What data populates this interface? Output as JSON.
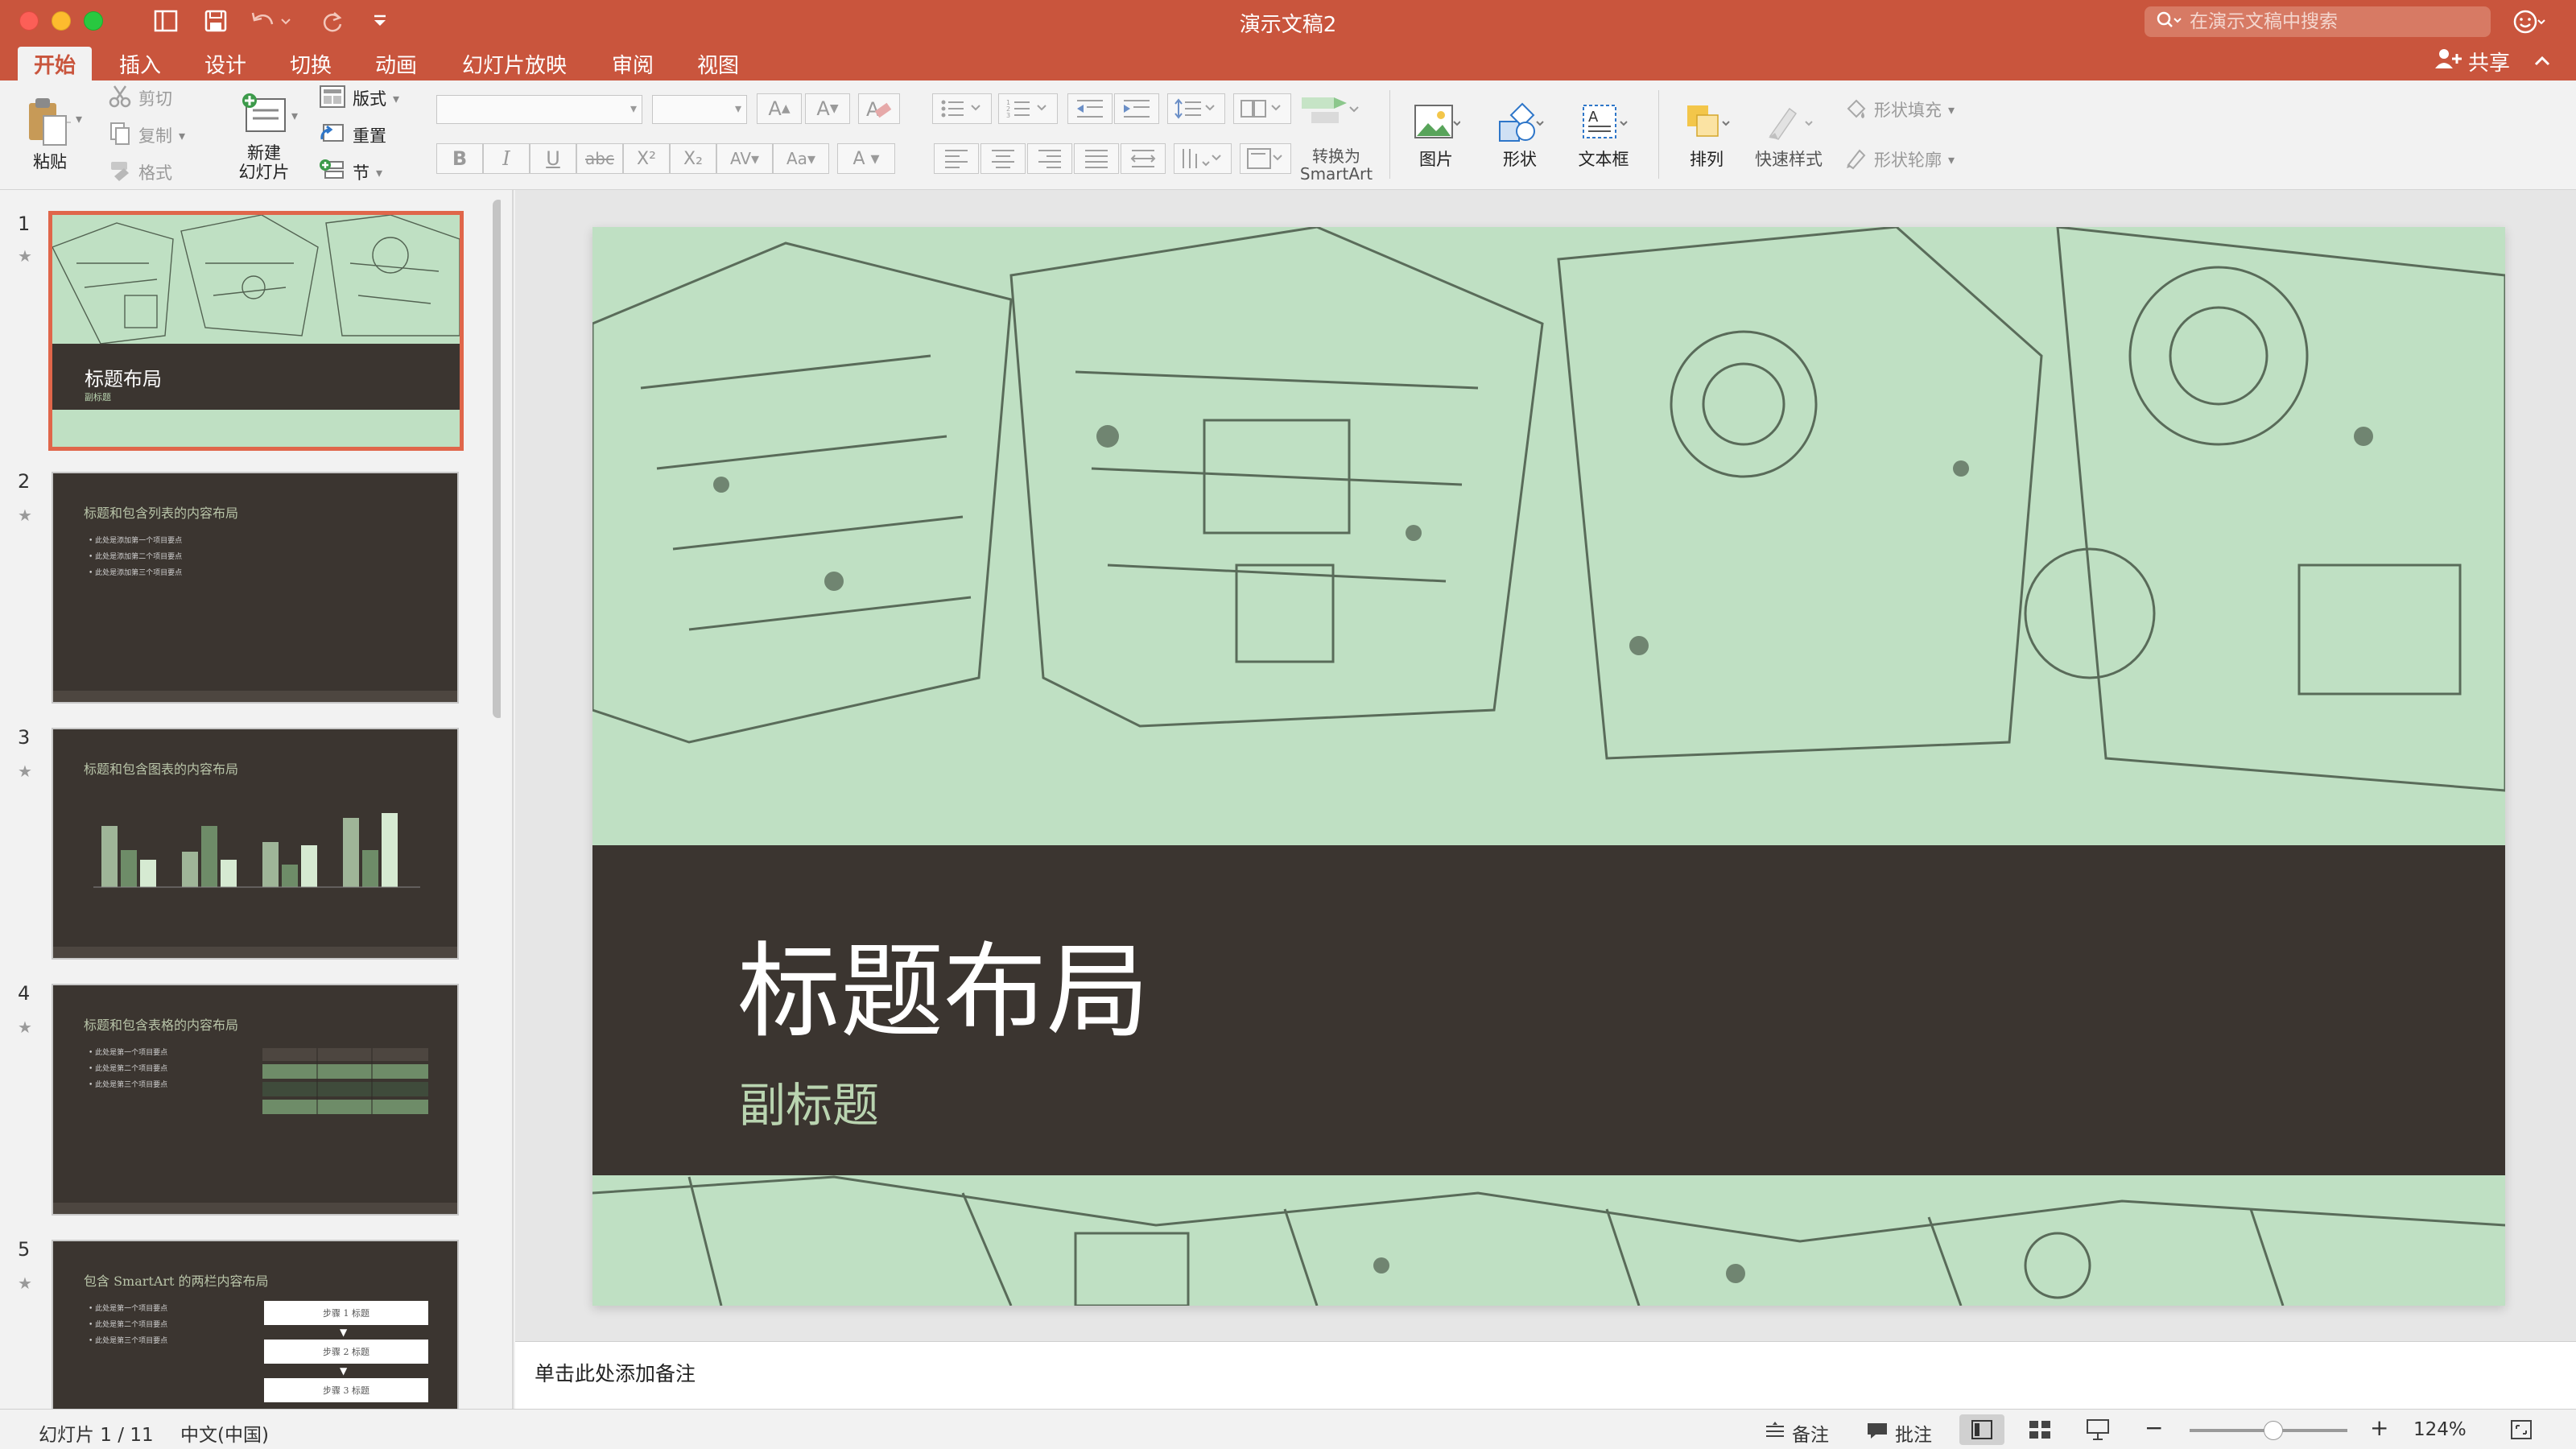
{
  "window": {
    "title": "演示文稿2"
  },
  "search": {
    "placeholder": "在演示文稿中搜索"
  },
  "tabs": [
    {
      "label": "开始",
      "active": true
    },
    {
      "label": "插入"
    },
    {
      "label": "设计"
    },
    {
      "label": "切换"
    },
    {
      "label": "动画"
    },
    {
      "label": "幻灯片放映"
    },
    {
      "label": "审阅"
    },
    {
      "label": "视图"
    }
  ],
  "share_label": "共享",
  "ribbon": {
    "paste": "粘贴",
    "cut": "剪切",
    "copy": "复制",
    "format": "格式",
    "new_slide_1": "新建",
    "new_slide_2": "幻灯片",
    "layout": "版式",
    "reset": "重置",
    "section": "节",
    "convert_1": "转换为",
    "convert_2": "SmartArt",
    "picture": "图片",
    "shape": "形状",
    "textbox": "文本框",
    "arrange": "排列",
    "quick_styles": "快速样式",
    "shape_fill": "形状填充",
    "shape_outline": "形状轮廓"
  },
  "thumbnails": [
    {
      "num": "1",
      "title": "标题布局",
      "subtitle": "副标题"
    },
    {
      "num": "2",
      "title": "标题和包含列表的内容布局",
      "bullets": [
        "此处是添加第一个项目要点",
        "此处是添加第二个项目要点",
        "此处是添加第三个项目要点"
      ]
    },
    {
      "num": "3",
      "title": "标题和包含图表的内容布局"
    },
    {
      "num": "4",
      "title": "标题和包含表格的内容布局",
      "bullets": [
        "此处是第一个项目要点",
        "此处是第二个项目要点",
        "此处是第三个项目要点"
      ]
    },
    {
      "num": "5",
      "title": "包含 SmartArt 的两栏内容布局",
      "bullets": [
        "此处是第一个项目要点",
        "此处是第二个项目要点",
        "此处是第三个项目要点"
      ],
      "steps": [
        "步骤 1 标题",
        "步骤 2 标题",
        "步骤 3 标题"
      ]
    }
  ],
  "slide": {
    "title": "标题布局",
    "subtitle": "副标题"
  },
  "notes_placeholder": "单击此处添加备注",
  "status": {
    "slide_counter": "幻灯片 1 / 11",
    "language": "中文(中国)",
    "notes": "备注",
    "comments": "批注",
    "zoom": "124%"
  },
  "colors": {
    "accent": "#c9553d",
    "slide_dark": "#3b3530",
    "slide_green": "#bfe0c3"
  }
}
